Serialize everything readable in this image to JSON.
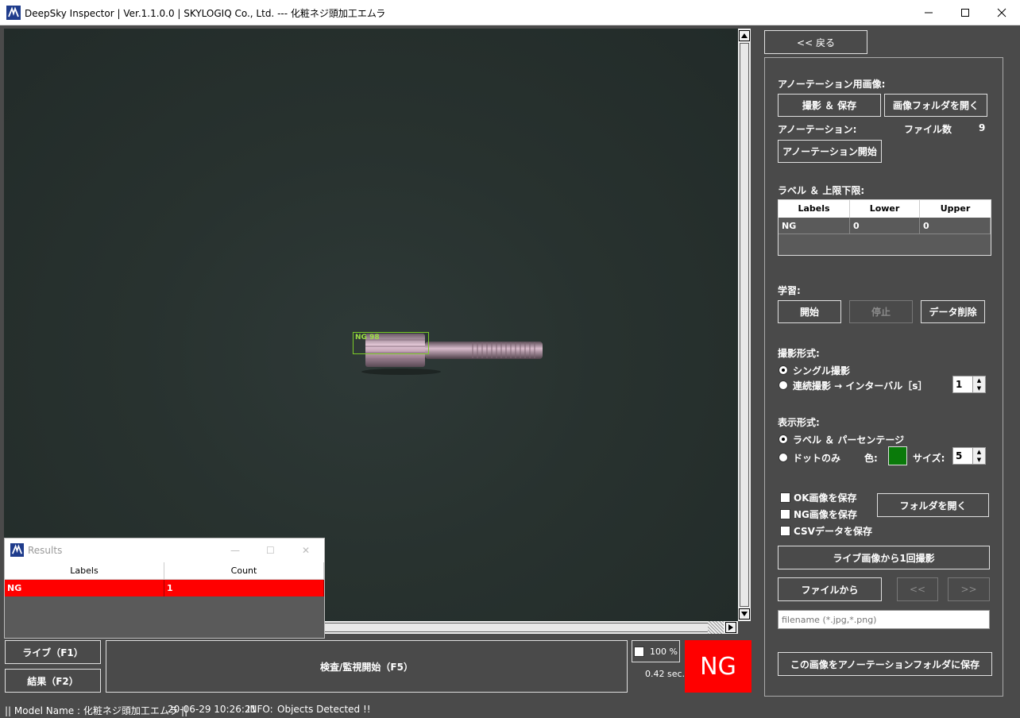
{
  "window": {
    "title": "DeepSky Inspector | Ver.1.1.0.0 | SKYLOGIQ Co., Ltd. --- 化粧ネジ頭加工エムラ"
  },
  "camera": {
    "detection_label": "NG 98"
  },
  "results": {
    "title": "Results",
    "headers": [
      "Labels",
      "Count"
    ],
    "rows": [
      [
        "NG",
        "1"
      ]
    ]
  },
  "bottom": {
    "live_button": "ライブ（F1）",
    "result_button": "結果（F2）",
    "inspect_button": "検査/監視開始（F5）",
    "zoom_label": "100 %",
    "elapsed": "0.42 sec.",
    "verdict": "NG"
  },
  "status": {
    "model": "|| Model Name : 化粧ネジ頭加工エムラ ||",
    "datetime": "20-06-29 10:26:21",
    "info_label": "INFO:",
    "info_text": "Objects Detected !!"
  },
  "panel": {
    "back_button": "<< 戻る",
    "annotation_image_label": "アノーテーション用画像:",
    "capture_save_button": "撮影 ＆ 保存",
    "open_image_folder_button": "画像フォルダを開く",
    "annotation_label": "アノーテーション:",
    "file_count_label": "ファイル数",
    "file_count": "9",
    "annotation_start_button": "アノーテーション開始",
    "label_limits_label": "ラベル ＆ 上限下限:",
    "table": {
      "headers": [
        "Labels",
        "Lower",
        "Upper"
      ],
      "rows": [
        [
          "NG",
          "0",
          "0"
        ]
      ]
    },
    "learning_label": "学習:",
    "start_button": "開始",
    "stop_button": "停止",
    "delete_data_button": "データ削除",
    "capture_mode_label": "撮影形式:",
    "single_capture": "シングル撮影",
    "continuous_capture": "連続撮影 → インターバル［s］",
    "interval_value": "1",
    "display_mode_label": "表示形式:",
    "label_percentage": "ラベル ＆ パーセンテージ",
    "dots_only": "ドットのみ",
    "color_label": "色:",
    "dot_color": "#0a7a0a",
    "size_label": "サイズ:",
    "size_value": "5",
    "save_ok": "OK画像を保存",
    "save_ng": "NG画像を保存",
    "save_csv": "CSVデータを保存",
    "open_folder_button": "フォルダを開く",
    "capture_once_button": "ライブ画像から1回撮影",
    "from_file_button": "ファイルから",
    "prev_button": "<<",
    "next_button": ">>",
    "filename_placeholder": "filename (*.jpg,*.png)",
    "save_to_annotation_button": "この画像をアノーテーションフォルダに保存"
  }
}
